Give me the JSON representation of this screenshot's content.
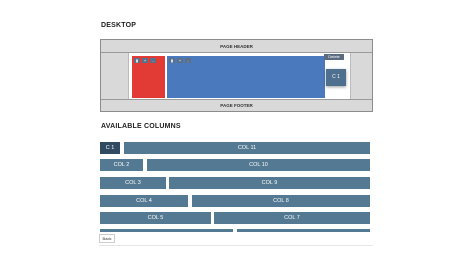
{
  "sections": {
    "desktop_title": "DESKTOP",
    "available_title": "AVAILABLE COLUMNS"
  },
  "desktop": {
    "header_label": "PAGE HEADER",
    "footer_label": "PAGE FOOTER",
    "delete_label": "Delete",
    "drag_chip_label": "C 1",
    "column_colors": {
      "left": "#e23a34",
      "main": "#4a79bd"
    },
    "mini_controls": [
      "▮",
      "+",
      "-"
    ]
  },
  "columns": {
    "row1": {
      "a": "C 1",
      "b": "COL 11"
    },
    "row2": {
      "a": "COL 2",
      "b": "COL 10"
    },
    "row3": {
      "a": "COL 3",
      "b": "COL 9"
    },
    "row4": {
      "a": "COL 4",
      "b": "COL 8"
    },
    "row5": {
      "a": "COL 5",
      "b": "COL 7"
    }
  },
  "back_label": "Back"
}
